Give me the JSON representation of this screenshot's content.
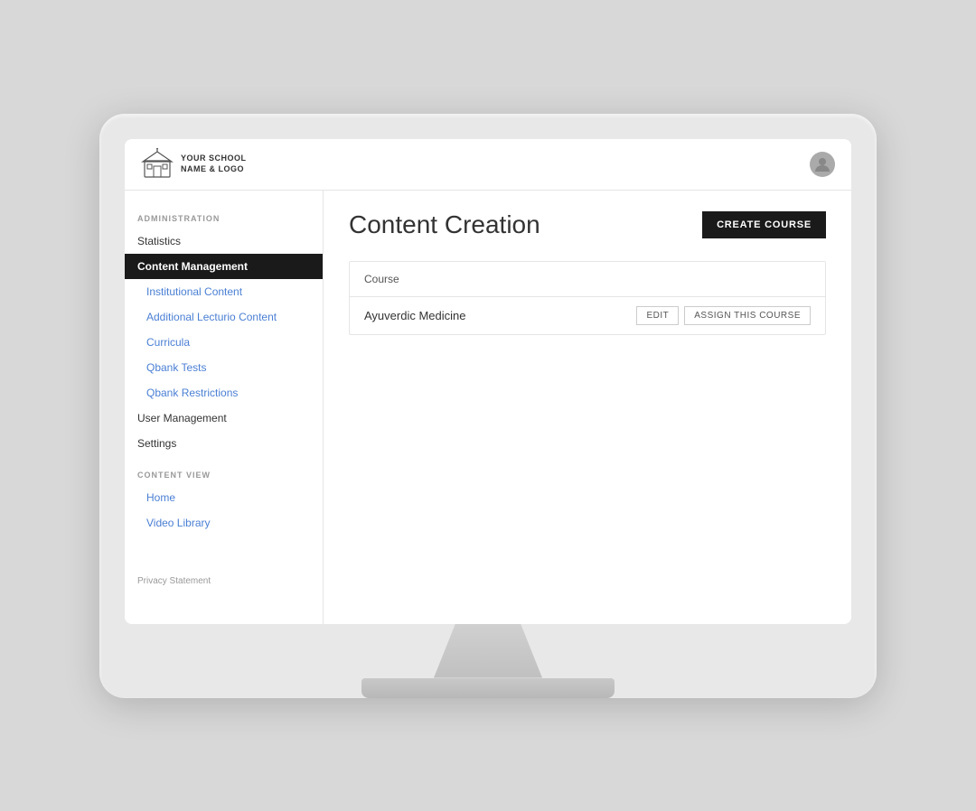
{
  "header": {
    "logo_text_line1": "YOUR SCHOOL",
    "logo_text_line2": "NAME & LOGO"
  },
  "sidebar": {
    "admin_section_label": "ADMINISTRATION",
    "items_admin": [
      {
        "id": "statistics",
        "label": "Statistics",
        "type": "plain"
      },
      {
        "id": "content-management",
        "label": "Content Management",
        "type": "active"
      }
    ],
    "items_content_management": [
      {
        "id": "institutional-content",
        "label": "Institutional Content",
        "type": "link"
      },
      {
        "id": "additional-lecturio-content",
        "label": "Additional Lecturio Content",
        "type": "link"
      },
      {
        "id": "curricula",
        "label": "Curricula",
        "type": "link"
      },
      {
        "id": "qbank-tests",
        "label": "Qbank Tests",
        "type": "link"
      },
      {
        "id": "qbank-restrictions",
        "label": "Qbank Restrictions",
        "type": "link"
      }
    ],
    "items_lower": [
      {
        "id": "user-management",
        "label": "User Management",
        "type": "plain"
      },
      {
        "id": "settings",
        "label": "Settings",
        "type": "plain"
      }
    ],
    "content_view_label": "CONTENT VIEW",
    "items_content_view": [
      {
        "id": "home",
        "label": "Home",
        "type": "link"
      },
      {
        "id": "video-library",
        "label": "Video Library",
        "type": "link"
      }
    ],
    "footer_link": "Privacy Statement"
  },
  "main": {
    "page_title": "Content Creation",
    "create_button_label": "CREATE COURSE",
    "table": {
      "column_label": "Course",
      "rows": [
        {
          "id": "row-1",
          "course_name": "Ayuverdic Medicine",
          "edit_label": "EDIT",
          "assign_label": "ASSIGN THIS COURSE"
        }
      ]
    }
  }
}
